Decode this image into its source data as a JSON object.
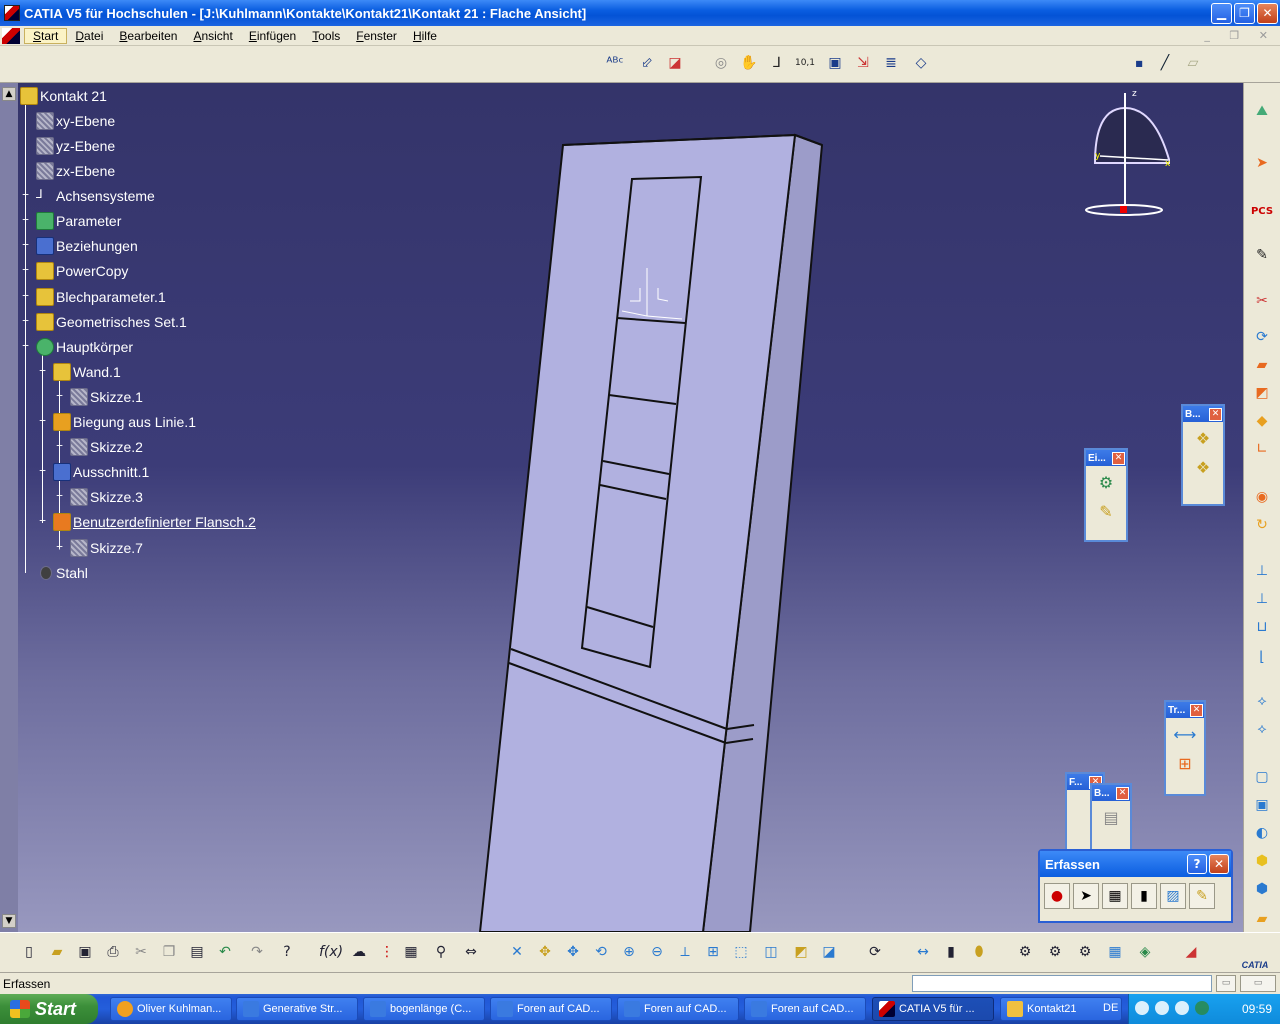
{
  "window": {
    "title": "CATIA V5 für Hochschulen - [J:\\Kuhlmann\\Kontakte\\Kontakt21\\Kontakt 21 : Flache Ansicht]",
    "minimize_glyph": "▁",
    "restore_glyph": "❐",
    "close_glyph": "✕"
  },
  "menu": {
    "items": [
      "Start",
      "Datei",
      "Bearbeiten",
      "Ansicht",
      "Einfügen",
      "Tools",
      "Fenster",
      "Hilfe"
    ],
    "mdi_controls": "_ ❐ ✕"
  },
  "tree": {
    "root": "Kontakt 21",
    "nodes": [
      {
        "label": "xy-Ebene",
        "icon": "plane-icon"
      },
      {
        "label": "yz-Ebene",
        "icon": "plane-icon"
      },
      {
        "label": "zx-Ebene",
        "icon": "plane-icon"
      },
      {
        "label": "Achsensysteme",
        "icon": "axis-system-icon"
      },
      {
        "label": "Parameter",
        "icon": "parameter-icon"
      },
      {
        "label": "Beziehungen",
        "icon": "relations-icon"
      },
      {
        "label": "PowerCopy",
        "icon": "powercopy-icon"
      },
      {
        "label": "Blechparameter.1",
        "icon": "sheetmetal-parameter-icon"
      },
      {
        "label": "Geometrisches Set.1",
        "icon": "geometric-set-icon"
      },
      {
        "label": "Hauptkörper",
        "icon": "partbody-icon"
      },
      {
        "label": "Wand.1",
        "icon": "wall-icon"
      },
      {
        "label": "Skizze.1",
        "icon": "sketch-icon"
      },
      {
        "label": "Biegung aus Linie.1",
        "icon": "bend-icon"
      },
      {
        "label": "Skizze.2",
        "icon": "sketch-icon"
      },
      {
        "label": "Ausschnitt.1",
        "icon": "cutout-icon"
      },
      {
        "label": "Skizze.3",
        "icon": "sketch-icon"
      },
      {
        "label": "Benutzerdefinierter Flansch.2",
        "icon": "flange-icon"
      },
      {
        "label": "Skizze.7",
        "icon": "sketch-icon"
      },
      {
        "label": "Stahl",
        "icon": "material-icon"
      }
    ]
  },
  "compass": {
    "x": "x",
    "y": "y",
    "z": "z"
  },
  "mini_toolbars": {
    "eins": "Ei...",
    "b1": "B...",
    "tr": "Tr...",
    "f": "F...",
    "b2": "B..."
  },
  "erfassen": {
    "title": "Erfassen",
    "help": "?",
    "close": "✕"
  },
  "statusbar": {
    "text": "Erfassen"
  },
  "bottom": {
    "catia_logo": "CATIA"
  },
  "taskbar": {
    "start": "Start",
    "tasks": [
      "Oliver Kuhlman...",
      "Generative Str...",
      "bogenlänge (C...",
      "Foren auf CAD...",
      "Foren auf CAD...",
      "Foren auf CAD...",
      "CATIA V5 für ...",
      "Kontakt21"
    ],
    "language": "DE",
    "clock": "09:59"
  },
  "colors": {
    "viewport_top": "#34346a",
    "viewport_bottom": "#9898bf",
    "part_face": "#b1b1e0",
    "title_blue": "#0a5de0"
  }
}
